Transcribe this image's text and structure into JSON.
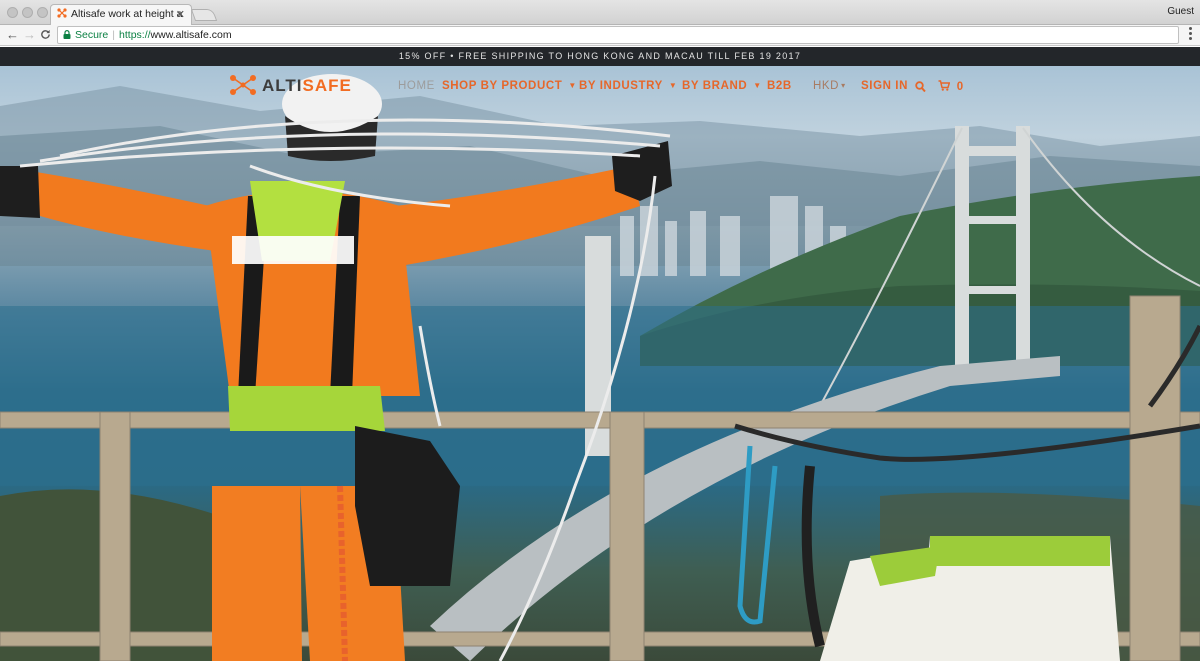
{
  "browser": {
    "tab_title": "Altisafe work at height and pe",
    "tab_close": "✕",
    "profile": "Guest",
    "back": "←",
    "forward": "→",
    "reload": "C",
    "secure_label": "Secure",
    "url_protocol": "https://",
    "url_host": "www.altisafe.com"
  },
  "promo": {
    "text": "15% OFF • FREE SHIPPING TO HONG KONG AND MACAU TILL FEB 19 2017"
  },
  "logo": {
    "part1": "ALTI",
    "part2": "SAFE"
  },
  "nav": {
    "items": [
      {
        "label": "HOME"
      },
      {
        "label": "SHOP BY PRODUCT"
      },
      {
        "label": "BY INDUSTRY"
      },
      {
        "label": "BY BRAND"
      },
      {
        "label": "B2B"
      },
      {
        "label": "HKD"
      },
      {
        "label": "SIGN IN"
      }
    ],
    "cart_count": "0"
  },
  "colors": {
    "accent": "#f26c22",
    "promo_bg": "#23262a"
  },
  "icons": [
    "search-icon",
    "cart-icon",
    "chevron-down-icon",
    "lock-icon"
  ]
}
